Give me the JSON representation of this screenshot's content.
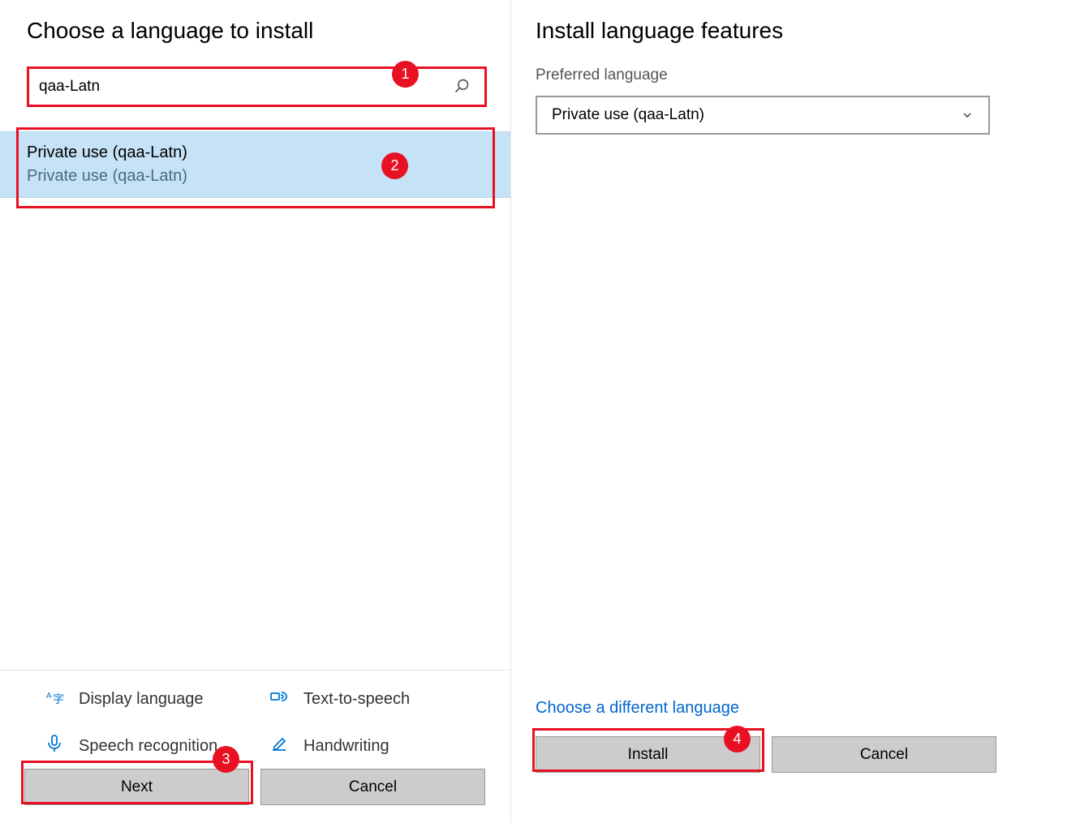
{
  "left": {
    "title": "Choose a language to install",
    "search_value": "qaa-Latn",
    "result": {
      "primary": "Private use (qaa-Latn)",
      "secondary": "Private use (qaa-Latn)"
    },
    "features": {
      "display": "Display language",
      "tts": "Text-to-speech",
      "speech": "Speech recognition",
      "hand": "Handwriting"
    },
    "next": "Next",
    "cancel": "Cancel"
  },
  "right": {
    "title": "Install language features",
    "pref_label": "Preferred language",
    "dropdown_value": "Private use (qaa-Latn)",
    "choose_link": "Choose a different language",
    "install": "Install",
    "cancel": "Cancel"
  },
  "callouts": {
    "c1": "1",
    "c2": "2",
    "c3": "3",
    "c4": "4"
  }
}
